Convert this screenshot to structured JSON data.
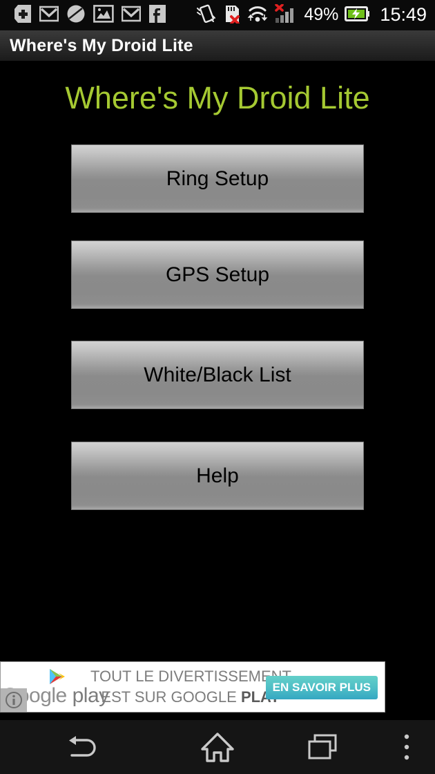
{
  "status_bar": {
    "left_icons": [
      {
        "name": "app-update-icon",
        "label": "plus-badge"
      },
      {
        "name": "gmail-icon",
        "label": "Gmail"
      },
      {
        "name": "mute-circle-icon",
        "label": "silent-mode"
      },
      {
        "name": "gallery-photo-icon",
        "label": "Gallery"
      },
      {
        "name": "gmail-icon-2",
        "label": "Gmail"
      },
      {
        "name": "facebook-icon",
        "label": "Facebook"
      }
    ],
    "right_icons": [
      {
        "name": "shake-rotate-icon",
        "label": "motion"
      },
      {
        "name": "sd-card-error-icon",
        "label": "sd-card-removed"
      },
      {
        "name": "wifi-transfer-icon",
        "label": "wifi-active"
      },
      {
        "name": "signal-no-service-icon",
        "label": "no-signal"
      }
    ],
    "battery_percent": "49%",
    "battery_icon": "battery-charging-icon",
    "clock": "15:49"
  },
  "title_bar": {
    "title": "Where's My Droid Lite"
  },
  "main": {
    "heading": "Where's My Droid Lite",
    "buttons": [
      {
        "id": "ring",
        "label": "Ring Setup"
      },
      {
        "id": "gps",
        "label": "GPS Setup"
      },
      {
        "id": "list",
        "label": "White/Black List"
      },
      {
        "id": "help",
        "label": "Help"
      }
    ]
  },
  "ad": {
    "brand_google": "Google",
    "brand_play": "play",
    "logo_icon": "google-play-triangle-icon",
    "line1": "TOUT LE DIVERTISSEMENT",
    "line2_prefix": "EST SUR GOOGLE ",
    "line2_strong": "PLAY",
    "cta_label": "EN SAVOIR PLUS",
    "info_icon": "ad-info-icon"
  },
  "nav_bar": {
    "back": "back-icon",
    "home": "home-icon",
    "recents": "recents-icon",
    "menu": "overflow-menu-icon"
  },
  "colors": {
    "accent_green": "#a5c932",
    "ad_cta_teal": "#4fbfc6",
    "background": "#000000",
    "error_red": "#e02020"
  }
}
